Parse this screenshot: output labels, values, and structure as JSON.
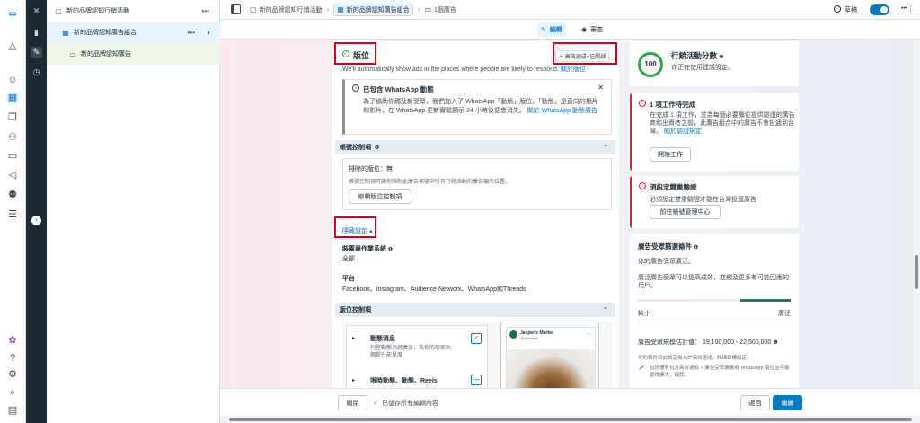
{
  "global_nav": {
    "icons": [
      "meta-logo-icon",
      "bell-icon",
      "smiley-icon",
      "table-icon",
      "pages-icon",
      "people-icon",
      "card-icon",
      "megaphone-icon",
      "audience-icon",
      "menu-icon",
      "flower-icon",
      "help-icon",
      "settings-icon",
      "search-icon",
      "reports-icon"
    ]
  },
  "dark_nav": {
    "icons": [
      "close-icon",
      "chart-icon",
      "edit-icon",
      "clock-icon",
      "expand-icon"
    ]
  },
  "tree": {
    "campaign": "新的品牌認知行銷活動",
    "adset": "新的品牌認知廣告組合",
    "ad": "新的品牌認知廣告",
    "more": "•••"
  },
  "topbar": {
    "crumb1": "新的品牌認知行銷活動",
    "crumb2": "新的品牌認知廣告組合",
    "crumb3": "1個廣告",
    "draft": "草稿",
    "more": "•••"
  },
  "tabs": {
    "edit": "編輯",
    "review": "審查"
  },
  "placement": {
    "title": "版位",
    "badge": "高效速成+已開啟",
    "description": "We'll automatically show ads in the places where people are likely to respond.",
    "description_link": "關於版位",
    "whatsapp_title": "已包含 WhatsApp 動態",
    "whatsapp_body": "為了協助你觸及新受眾，我們加入了 WhatsApp「動態」版位。「動態」是直向的相片和影片，在 WhatsApp 更新實驗顯示 24 小時後便會消失。",
    "whatsapp_link": "關於 WhatsApp 動態廣告",
    "account_controls_title": "帳號控制項",
    "excluded_label": "排除的版位：無",
    "account_controls_note": "帳號控制項可讓你限制此廣告帳號中所有行銷活動的廣告顯示位置。",
    "edit_controls_button": "編輯版位控制項",
    "hide_settings": "隱藏設定",
    "devices_label": "裝置與作業系統",
    "devices_value": "全部",
    "platform_label": "平台",
    "platform_value": "Facebook、Instagram、Audience Network、WhatsApp和Threads",
    "placement_controls_title": "版位控制項",
    "feed_label": "動態消息",
    "feed_desc": "刊登動態消息廣告，為你的商家大幅提升能見度",
    "stories_label": "限時動態、動態、Reels",
    "preview_page": "Jasper's Market",
    "preview_sub": "Sponsored"
  },
  "score": {
    "value": "100",
    "title": "行銷活動分數",
    "subtitle": "你正在使用建議設定。"
  },
  "task1": {
    "title": "1 項工作待完成",
    "body": "在完成 1 項工作，並為每個必要欄位提供驗證的廣告商和出資者之前，此廣告組合中的廣告不會投遞到台灣。",
    "link": "關於驗證規定",
    "button": "開始工作"
  },
  "task2": {
    "title": "須設定雙重驗證",
    "body": "必須設定雙重驗證才能在台灣投遞廣告",
    "button": "前往帳號管理中心"
  },
  "audience": {
    "title": "廣告受眾篩選條件",
    "status": "你的廣告受眾廣泛。",
    "desc": "廣泛廣告受眾可以提高成效，並觸及更多有可能回應的用戶。",
    "narrow": "較小",
    "broad": "廣泛",
    "estimate_label": "廣告受眾規模估計值：",
    "estimate_value": "19,100,000 - 22,500,000",
    "note": "你的條件目前設定為允許高效速成，詳細目標設定。",
    "whatsapp_note": "包括僅有包含高效速成 + 廣告受眾擴展或 WhatsApp 版位並可能變得擴大，確認。"
  },
  "bottom": {
    "close": "關閉",
    "saved": "已儲存所有編輯內容",
    "back": "返回",
    "next": "繼續"
  }
}
